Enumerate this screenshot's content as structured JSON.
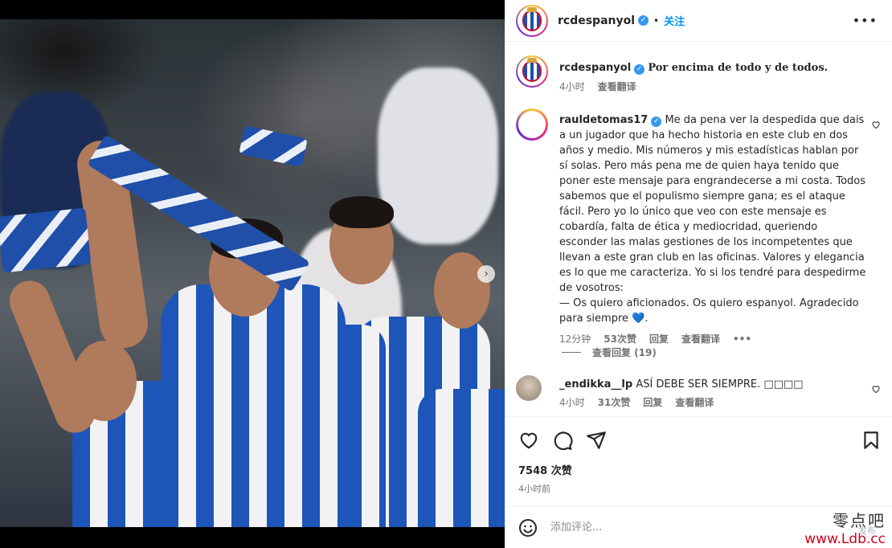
{
  "post": {
    "author": "rcdespanyol",
    "follow_label": "关注",
    "caption": "Por encima de todo y de todos.",
    "caption_time": "4小时",
    "caption_translate": "查看翻译",
    "likes": "7548 次赞",
    "posted_ago": "4小时前"
  },
  "comments": [
    {
      "user": "rauldetomas17",
      "text": "Me da pena ver la despedida que dais a un jugador que ha hecho historia en este club en dos años y medio. Mis números y mis estadísticas hablan por sí solas. Pero más pena me de quien haya tenido que poner este mensaje para engrandecerse a mi costa. Todos sabemos que el populismo siempre gana; es el ataque fácil. Pero yo lo único que veo con este mensaje es cobardía, falta de ética y mediocridad, queriendo esconder las malas gestiones de los incompetentes que llevan a este gran club en las oficinas. Valores y elegancia es lo que me caracteriza. Yo si los tendré para despedirme de vosotros:",
      "text2": "— Os quiero aficionados. Os quiero espanyol. Agradecido para siempre",
      "emoji": "💙",
      "time": "12分钟",
      "likes": "53次赞",
      "reply": "回复",
      "translate": "查看翻译",
      "more": "•••",
      "view_replies": "查看回复 (19)"
    },
    {
      "user": "_endikka__lp",
      "text": "ASÍ DEBE SER SIEMPRE. □□□□",
      "time": "4小时",
      "likes": "31次赞",
      "reply": "回复",
      "translate": "查看翻译"
    }
  ],
  "composer": {
    "placeholder": "添加评论..."
  },
  "watermark": {
    "title": "零点吧",
    "url": "www.Ldb.cc",
    "publish": "发布"
  },
  "colors": {
    "link_blue": "#0095f6",
    "verified_blue": "#3897f0",
    "muted_text": "#737373"
  }
}
